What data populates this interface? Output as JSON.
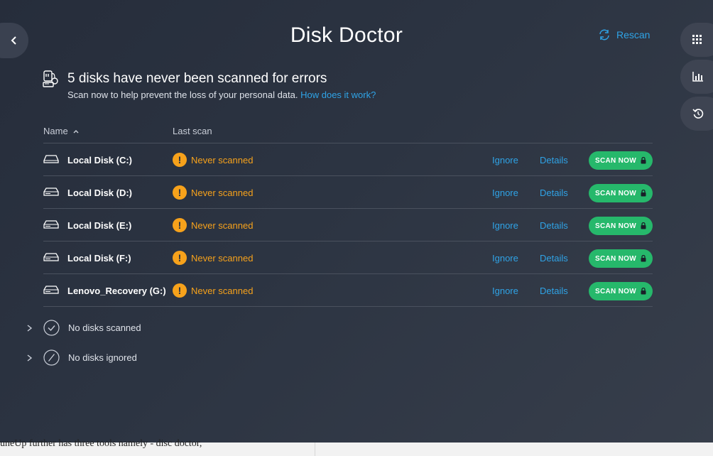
{
  "app": {
    "title": "Disk Doctor",
    "rescan_label": "Rescan"
  },
  "summary": {
    "headline": "5 disks have never been scanned for errors",
    "subtext": "Scan now to help prevent the loss of your personal data.",
    "link": "How does it work?"
  },
  "table": {
    "col_name": "Name",
    "col_last_scan": "Last scan",
    "ignore_label": "Ignore",
    "details_label": "Details",
    "scan_label": "SCAN NOW",
    "rows": [
      {
        "name": "Local Disk (C:)",
        "status": "Never scanned"
      },
      {
        "name": "Local Disk (D:)",
        "status": "Never scanned"
      },
      {
        "name": "Local Disk (E:)",
        "status": "Never scanned"
      },
      {
        "name": "Local Disk (F:)",
        "status": "Never scanned"
      },
      {
        "name": "Lenovo_Recovery (G:)",
        "status": "Never scanned"
      }
    ]
  },
  "groups": {
    "scanned": "No disks scanned",
    "ignored": "No disks ignored"
  },
  "background_text": "uneUp further has three tools namely - disc doctor,",
  "colors": {
    "accent_blue": "#2fa3e6",
    "warning_orange": "#f7a21b",
    "scan_green": "#26b86b",
    "background": "#2c3442"
  },
  "icons": {
    "back": "chevron-left-icon",
    "rescan": "refresh-icon",
    "apps": "apps-grid-icon",
    "stats": "bar-chart-icon",
    "history": "undo-icon",
    "header": "disk-doctor-icon",
    "disk": "hard-drive-icon",
    "warning": "warning-icon",
    "lock": "lock-icon",
    "expand": "chevron-right-icon",
    "scanned": "check-circle-icon",
    "ignored": "slash-circle-icon"
  }
}
